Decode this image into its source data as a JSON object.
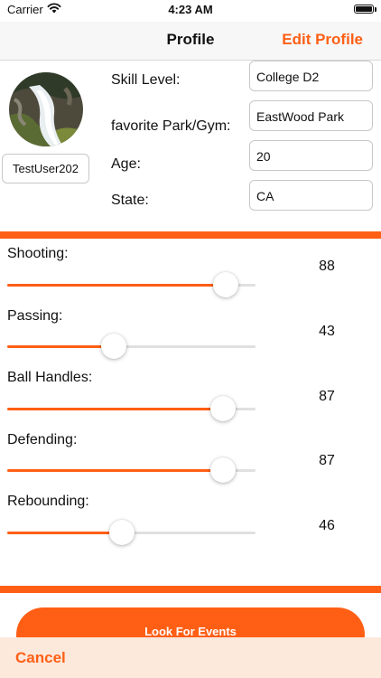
{
  "status_bar": {
    "carrier": "Carrier",
    "time": "4:23 AM"
  },
  "nav": {
    "title": "Profile",
    "edit_label": "Edit Profile"
  },
  "profile": {
    "username": "TestUser202",
    "fields": [
      {
        "label": "Skill Level:",
        "value": "College D2"
      },
      {
        "label": "favorite Park/Gym:",
        "value": "EastWood Park"
      },
      {
        "label": "Age:",
        "value": "20"
      },
      {
        "label": "State:",
        "value": "CA"
      }
    ]
  },
  "skills": [
    {
      "label": "Shooting:",
      "value": "88",
      "level": 0.88
    },
    {
      "label": "Passing:",
      "value": "43",
      "level": 0.43
    },
    {
      "label": "Ball Handles:",
      "value": "87",
      "level": 0.87
    },
    {
      "label": "Defending:",
      "value": "87",
      "level": 0.87
    },
    {
      "label": "Rebounding:",
      "value": "46",
      "level": 0.46
    }
  ],
  "actions": {
    "look_for_events": "Look For Events",
    "cancel": "Cancel"
  },
  "colors": {
    "accent": "#ff5f15",
    "bottom_bar": "#fde8dc",
    "track": "#e0e0e0"
  },
  "icons": [
    "wifi-icon",
    "battery-icon",
    "avatar-waterfall-photo"
  ]
}
